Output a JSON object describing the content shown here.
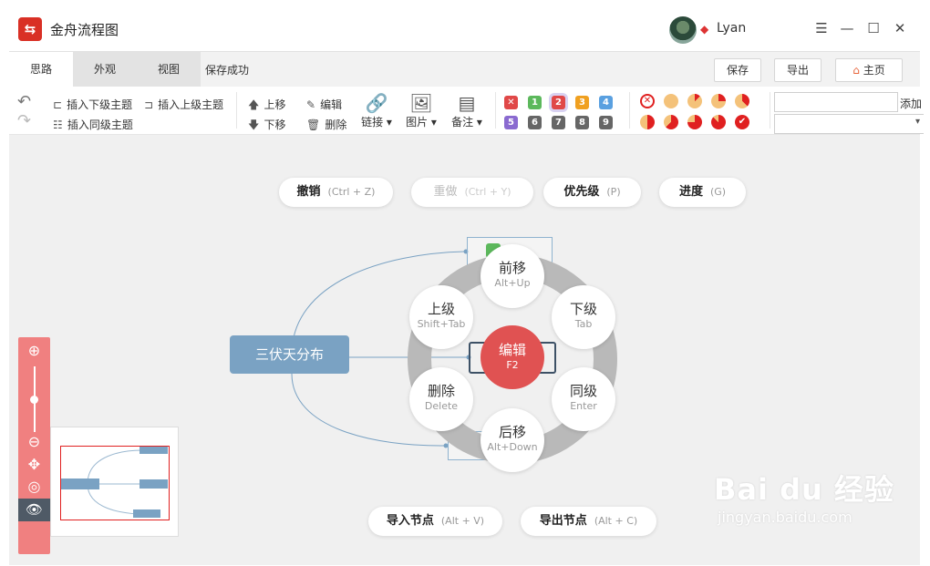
{
  "window": {
    "app_logo_glyph": "⇆",
    "title": "金舟流程图",
    "username": "Lyan",
    "controls": [
      "☰",
      "—",
      "☐",
      "✕"
    ]
  },
  "tabs": [
    {
      "label": "思路",
      "active": true
    },
    {
      "label": "外观"
    },
    {
      "label": "视图"
    }
  ],
  "save_status": "保存成功",
  "actions": {
    "save": "保存",
    "export": "导出",
    "home": "主页"
  },
  "toolbar": {
    "undo_icon": "↶",
    "redo_icon": "↷",
    "insert_child": "插入下级主题",
    "insert_parent": "插入上级主题",
    "insert_sibling": "插入同级主题",
    "move_up": "上移",
    "move_down": "下移",
    "edit": "编辑",
    "delete": "删除",
    "link": "链接",
    "image": "图片",
    "note": "备注",
    "add_label": "添加",
    "priority_row1": [
      "✕",
      "1",
      "2",
      "3",
      "4"
    ],
    "priority_row2": [
      "5",
      "6",
      "7",
      "8",
      "9"
    ],
    "priority_colors": {
      "x": "#e04848",
      "1": "#5cb85c",
      "2": "#e04848",
      "3": "#f0a020",
      "4": "#5aa0e0",
      "5": "#8a6ad0",
      "6": "#666666",
      "7": "#666666",
      "8": "#666666",
      "9": "#666666"
    }
  },
  "canvas": {
    "pills": [
      {
        "label": "撤销",
        "key": "(Ctrl + Z)",
        "enabled": true
      },
      {
        "label": "重做",
        "key": "(Ctrl + Y)",
        "enabled": false
      },
      {
        "label": "优先级",
        "key": "(P)",
        "enabled": true
      },
      {
        "label": "进度",
        "key": "(G)",
        "enabled": true
      }
    ],
    "main_node": "三伏天分布",
    "menu": {
      "forward": {
        "label": "前移",
        "key": "Alt+Up"
      },
      "child": {
        "label": "下级",
        "key": "Tab"
      },
      "sibling": {
        "label": "同级",
        "key": "Enter"
      },
      "backward": {
        "label": "后移",
        "key": "Alt+Down"
      },
      "delete": {
        "label": "删除",
        "key": "Delete"
      },
      "parent": {
        "label": "上级",
        "key": "Shift+Tab"
      },
      "edit": {
        "label": "编辑",
        "key": "F2"
      }
    },
    "bottom_pills": [
      {
        "label": "导入节点",
        "key": "(Alt + V)"
      },
      {
        "label": "导出节点",
        "key": "(Alt + C)"
      }
    ]
  },
  "watermark": {
    "brand": "Bai du 经验",
    "url": "jingyan.baidu.com"
  }
}
